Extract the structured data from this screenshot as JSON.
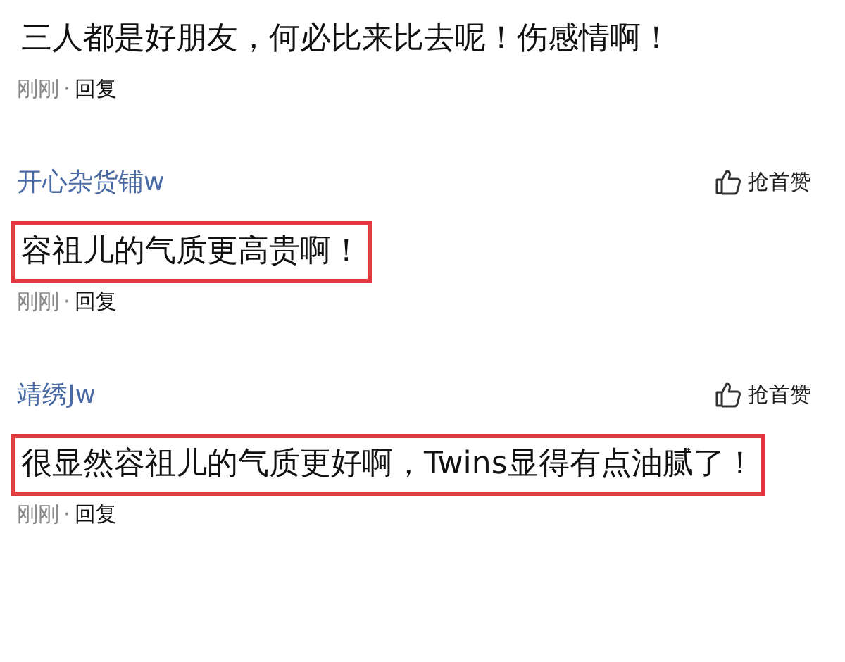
{
  "comments": [
    {
      "text": "三人都是好朋友，何必比来比去呢！伤感情啊！",
      "highlighted": false,
      "time": "刚刚",
      "separator": "·",
      "reply": "回复"
    },
    {
      "author": "开心杂货铺w",
      "like": "抢首赞",
      "text": "容祖儿的气质更高贵啊！",
      "highlighted": true,
      "time": "刚刚",
      "separator": "·",
      "reply": "回复"
    },
    {
      "author": "靖绣Jw",
      "like": "抢首赞",
      "text": "很显然容祖儿的气质更好啊，Twins显得有点油腻了！",
      "highlighted": true,
      "time": "刚刚",
      "separator": "·",
      "reply": "回复"
    }
  ]
}
